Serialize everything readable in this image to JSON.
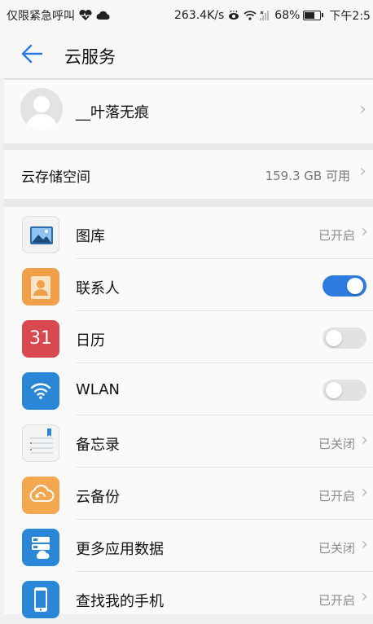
{
  "status_bar": {
    "carrier": "仅限紧急呼叫",
    "speed": "263.4K/s",
    "battery": "68%",
    "time": "下午2:5"
  },
  "header": {
    "title": "云服务"
  },
  "account": {
    "name": "__叶落无痕"
  },
  "storage": {
    "label": "云存储空间",
    "value": "159.3 GB 可用"
  },
  "items": [
    {
      "label": "图库",
      "status": "已开启",
      "icon": "gallery-icon"
    },
    {
      "label": "联系人",
      "toggle": "on",
      "icon": "contacts-icon"
    },
    {
      "label": "日历",
      "toggle": "off",
      "icon": "calendar-icon",
      "icon_text": "31"
    },
    {
      "label": "WLAN",
      "toggle": "off",
      "icon": "wifi-icon"
    },
    {
      "label": "备忘录",
      "status": "已关闭",
      "icon": "notes-icon"
    },
    {
      "label": "云备份",
      "status": "已开启",
      "icon": "cloud-backup-icon"
    },
    {
      "label": "更多应用数据",
      "status": "已关闭",
      "icon": "app-data-icon"
    },
    {
      "label": "查找我的手机",
      "status": "已开启",
      "icon": "find-phone-icon"
    }
  ],
  "colors": {
    "accent": "#2e7be0",
    "contacts": "#f0a04a",
    "calendar": "#d9474f",
    "wlan": "#2a86d6",
    "backup": "#f3a74e",
    "app_data": "#2a86d6"
  }
}
